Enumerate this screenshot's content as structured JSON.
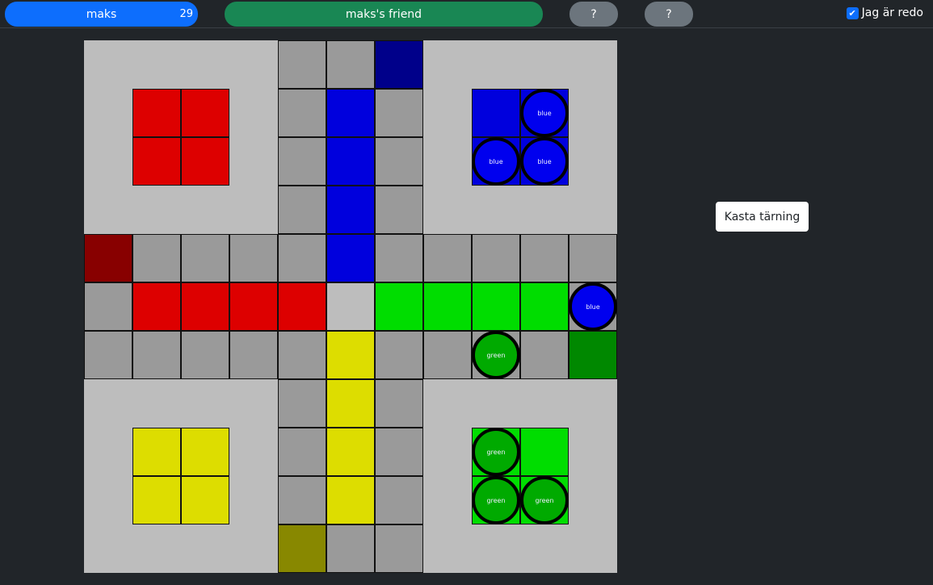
{
  "players": [
    {
      "name": "maks",
      "score": "29",
      "color": "#0d6efd"
    },
    {
      "name": "maks's friend",
      "score": "",
      "color": "#198754"
    },
    {
      "name": "?",
      "score": "",
      "color": "#6c757d"
    },
    {
      "name": "?",
      "score": "",
      "color": "#6c757d"
    }
  ],
  "ready": {
    "label": "Jag är redo",
    "checked": true
  },
  "roll_button": "Kasta tärning",
  "colors": {
    "board": "#bdbdbd",
    "track": "#9a9a9a",
    "red": "#dd0000",
    "red_start": "#880000",
    "blue": "#0000dd",
    "blue_start": "#00008a",
    "green": "#00dd00",
    "green_start": "#008800",
    "yellow": "#dddd00",
    "yellow_start": "#888800",
    "blue_token": "#0000ee",
    "green_token": "#00aa00"
  },
  "tokens": {
    "blue_label": "blue",
    "green_label": "green"
  }
}
